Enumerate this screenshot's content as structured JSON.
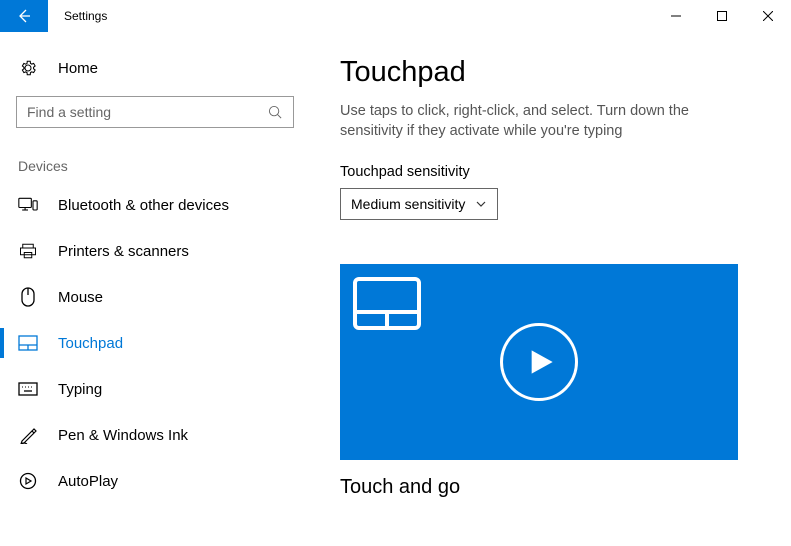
{
  "window": {
    "title": "Settings"
  },
  "sidebar": {
    "home": "Home",
    "search_placeholder": "Find a setting",
    "group": "Devices",
    "items": [
      {
        "label": "Bluetooth & other devices"
      },
      {
        "label": "Printers & scanners"
      },
      {
        "label": "Mouse"
      },
      {
        "label": "Touchpad"
      },
      {
        "label": "Typing"
      },
      {
        "label": "Pen & Windows Ink"
      },
      {
        "label": "AutoPlay"
      }
    ]
  },
  "main": {
    "heading": "Touchpad",
    "description": "Use taps to click, right-click, and select. Turn down the sensitivity if they activate while you're typing",
    "sensitivity_label": "Touchpad sensitivity",
    "sensitivity_value": "Medium sensitivity",
    "video_caption": "Touch and go"
  }
}
